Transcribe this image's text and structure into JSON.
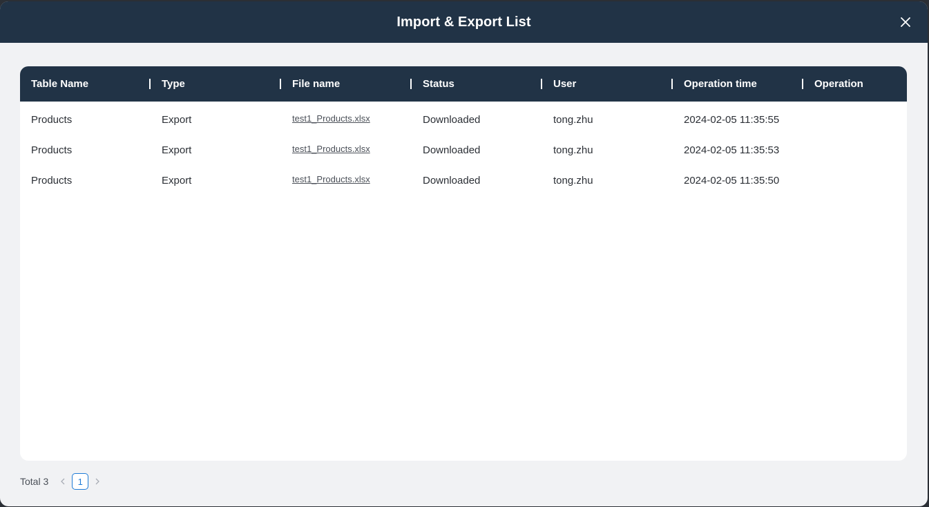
{
  "modal": {
    "title": "Import & Export List"
  },
  "table": {
    "columns": [
      "Table Name",
      "Type",
      "File name",
      "Status",
      "User",
      "Operation time",
      "Operation"
    ],
    "rows": [
      {
        "table_name": "Products",
        "type": "Export",
        "file_name": "test1_Products.xlsx",
        "status": "Downloaded",
        "user": "tong.zhu",
        "operation_time": "2024-02-05 11:35:55",
        "operation": ""
      },
      {
        "table_name": "Products",
        "type": "Export",
        "file_name": "test1_Products.xlsx",
        "status": "Downloaded",
        "user": "tong.zhu",
        "operation_time": "2024-02-05 11:35:53",
        "operation": ""
      },
      {
        "table_name": "Products",
        "type": "Export",
        "file_name": "test1_Products.xlsx",
        "status": "Downloaded",
        "user": "tong.zhu",
        "operation_time": "2024-02-05 11:35:50",
        "operation": ""
      }
    ]
  },
  "pagination": {
    "total_label": "Total 3",
    "current_page": "1",
    "prev_icon": "chevron-left-icon",
    "next_icon": "chevron-right-icon"
  },
  "colors": {
    "header_bg": "#213346",
    "accent": "#1e7bd6",
    "modal_bg": "#f1f2f4"
  }
}
